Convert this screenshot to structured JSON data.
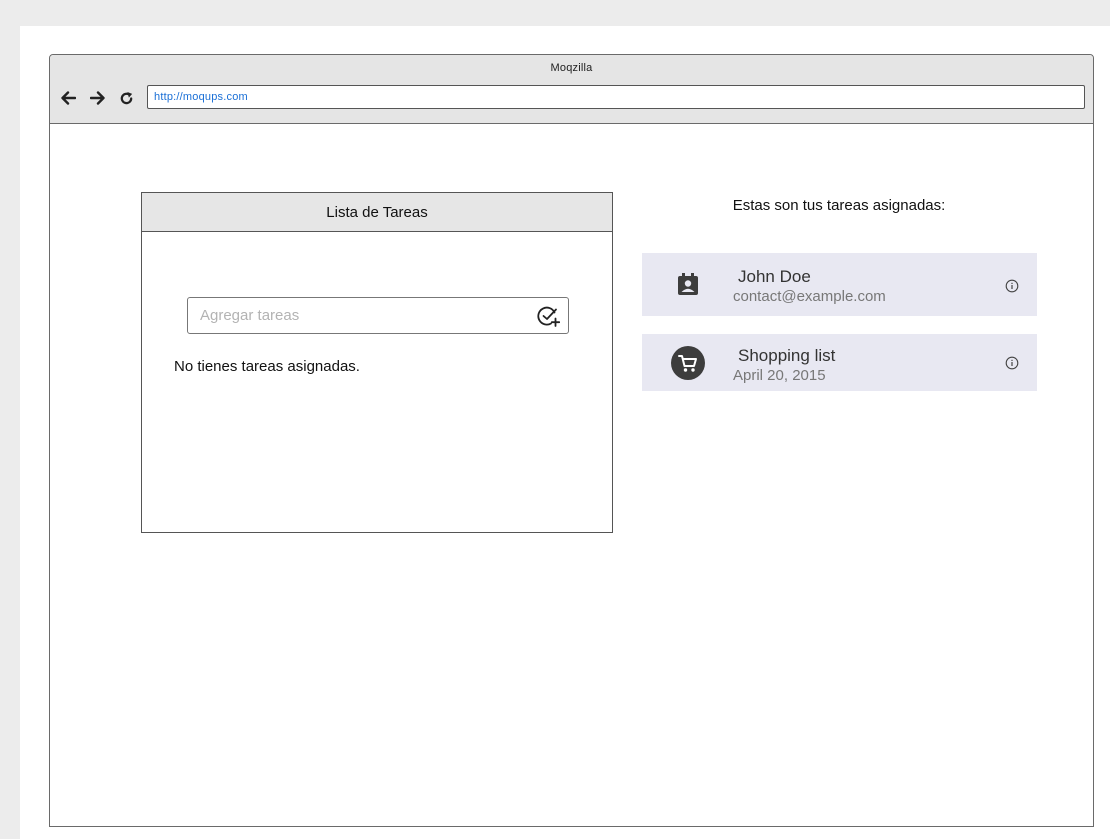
{
  "browser": {
    "title": "Moqzilla",
    "url": "http://moqups.com",
    "nav": {
      "back_icon": "arrow-left-icon",
      "forward_icon": "arrow-right-icon",
      "reload_icon": "reload-icon"
    }
  },
  "task_panel": {
    "header": "Lista de Tareas",
    "input_placeholder": "Agregar tareas",
    "input_value": "",
    "add_icon": "add-task-icon",
    "empty_message": "No tienes tareas asignadas."
  },
  "assigned": {
    "heading": "Estas son tus tareas asignadas:",
    "items": [
      {
        "icon": "contact-badge-icon",
        "title": "John Doe",
        "subtitle": "contact@example.com",
        "info_icon": "info-icon"
      },
      {
        "icon": "shopping-cart-icon",
        "title": "Shopping list",
        "subtitle": "April 20, 2015",
        "info_icon": "info-icon"
      }
    ]
  },
  "colors": {
    "card_background": "#e8e8f2",
    "url_text": "#1a6fd6",
    "panel_header": "#e6e6e6"
  }
}
